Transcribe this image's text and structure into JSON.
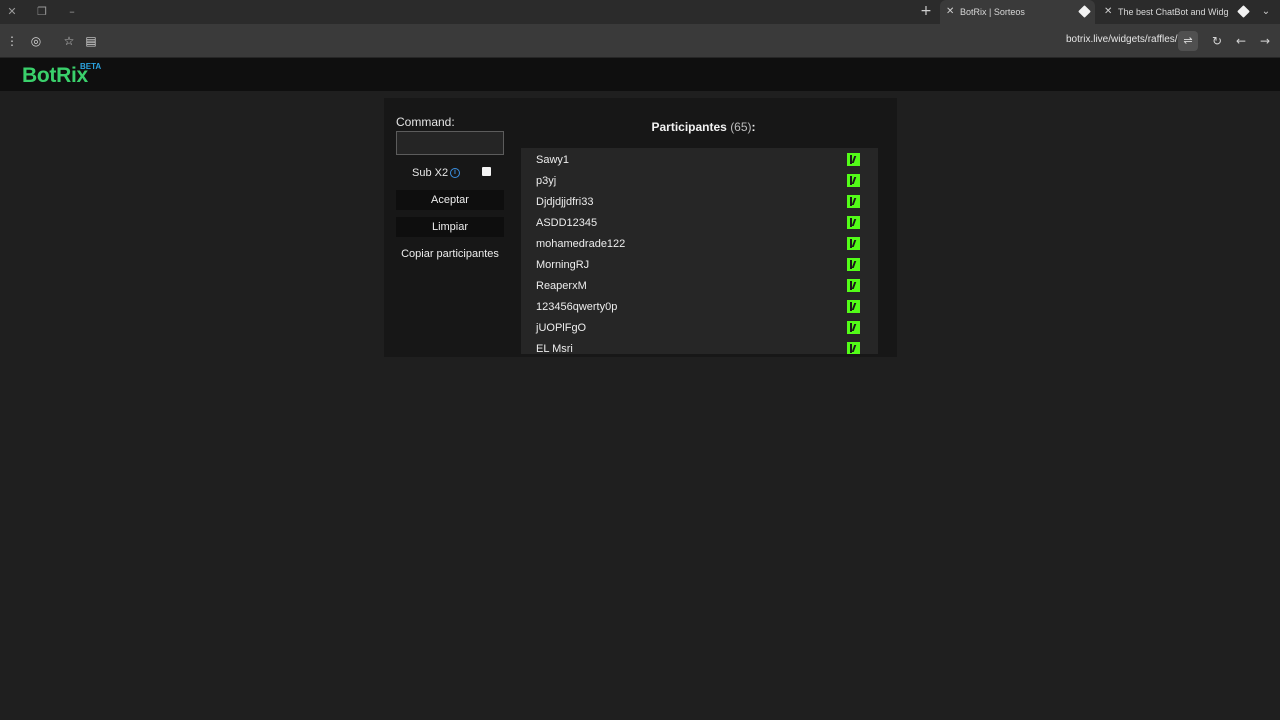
{
  "browser": {
    "tabs": [
      {
        "title": "BotRix | Sorteos",
        "active": true
      },
      {
        "title": "The best ChatBot and Widgets",
        "active": false
      }
    ],
    "url": "botrix.live/widgets/raffles/",
    "icons": [
      "close-icon",
      "restore-icon",
      "minimize-icon",
      "new-tab-icon",
      "tab-menu-icon",
      "menu-icon",
      "profile-icon",
      "bookmark-star-icon",
      "reader-mode-icon",
      "site-settings-icon",
      "reload-icon",
      "back-icon",
      "forward-icon"
    ]
  },
  "site": {
    "logo": "BotRix",
    "logo_badge": "BETA",
    "brand_color": "#3ad06b",
    "badge_color": "#2ba3e0"
  },
  "raffle": {
    "command_label": "Command:",
    "command_value": "",
    "sub_label": "Sub X2",
    "sub_checked": false,
    "accept_label": "Aceptar",
    "clear_label": "Limpiar",
    "copy_label": "Copiar participantes",
    "participants_title": "Participantes",
    "participants_count": "(65)",
    "participants_suffix": ":",
    "platform_icon": "kick-icon",
    "platform_color": "#53fc18",
    "participants": [
      "Sawy1",
      "p3yj",
      "Djdjdjjdfri33",
      "ASDD12345",
      "mohamedrade122",
      "MorningRJ",
      "ReaperxM",
      "123456qwerty0p",
      "jUOPlFgO",
      "EL Msri"
    ]
  }
}
